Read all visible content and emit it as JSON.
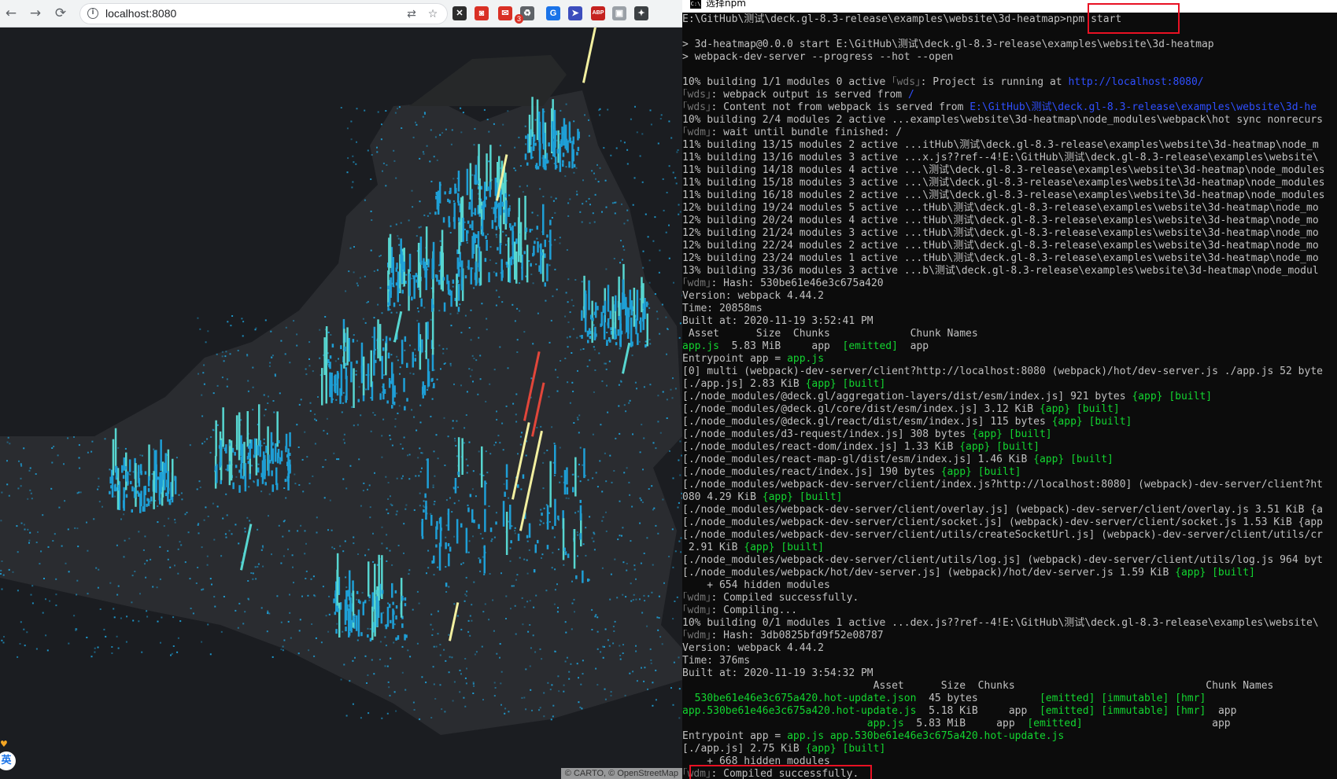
{
  "browser": {
    "url": "localhost:8080",
    "nav": {
      "back": "←",
      "forward": "→",
      "reload": "⟳"
    },
    "extensions": [
      {
        "name": "x-ext",
        "glyph": "✕",
        "color": "#2d2d2d"
      },
      {
        "name": "camera-ext",
        "glyph": "◙",
        "color": "#d93025"
      },
      {
        "name": "mail-ext",
        "glyph": "✉",
        "color": "#d93025"
      },
      {
        "name": "recycle-ext",
        "glyph": "♻",
        "color": "#5f6368"
      },
      {
        "name": "translate-ext",
        "glyph": "G",
        "color": "#1a73e8"
      },
      {
        "name": "cursor-ext",
        "glyph": "➤",
        "color": "#3c4dbd"
      },
      {
        "name": "abp-ext",
        "glyph": "ABP",
        "color": "#c5221f"
      },
      {
        "name": "capture-ext",
        "glyph": "▣",
        "color": "#9aa0a6"
      },
      {
        "name": "puzzle-ext",
        "glyph": "✦",
        "color": "#3c4043"
      }
    ],
    "mail_badge": "3",
    "map": {
      "attribution": "© CARTO, © OpenStreetMap",
      "accent_colors": [
        "#1e9fd6",
        "#57d6d0",
        "#f3f0a0",
        "#e2463a"
      ]
    },
    "ime": {
      "label": "英",
      "heart": "♥"
    }
  },
  "terminal": {
    "title": "选择npm",
    "lines": [
      [
        {
          "t": "E:\\GitHub\\测试\\deck.gl-8.3-release\\examples\\website\\3d-heatmap>npm start"
        }
      ],
      [
        {
          "t": ""
        }
      ],
      [
        {
          "t": "> 3d-heatmap@0.0.0 start E:\\GitHub\\测试\\deck.gl-8.3-release\\examples\\website\\3d-heatmap"
        }
      ],
      [
        {
          "t": "> webpack-dev-server --progress --hot --open"
        }
      ],
      [
        {
          "t": ""
        }
      ],
      [
        {
          "t": "10% building 1/1 modules 0 active "
        },
        {
          "t": "｢wds｣",
          "c": "gr"
        },
        {
          "t": ": Project is running at "
        },
        {
          "t": "http://localhost:8080/",
          "c": "b"
        }
      ],
      [
        {
          "t": "｢wds｣",
          "c": "gr"
        },
        {
          "t": ": webpack output is served from "
        },
        {
          "t": "/",
          "c": "b"
        }
      ],
      [
        {
          "t": "｢wds｣",
          "c": "gr"
        },
        {
          "t": ": Content not from webpack is served from "
        },
        {
          "t": "E:\\GitHub\\测试\\deck.gl-8.3-release\\examples\\website\\3d-he",
          "c": "b"
        }
      ],
      [
        {
          "t": "10% building 2/4 modules 2 active ...examples\\website\\3d-heatmap\\node_modules\\webpack\\hot sync nonrecurs"
        }
      ],
      [
        {
          "t": "｢wdm｣",
          "c": "gr"
        },
        {
          "t": ": wait until bundle finished: /"
        }
      ],
      [
        {
          "t": "11% building 13/15 modules 2 active ...itHub\\测试\\deck.gl-8.3-release\\examples\\website\\3d-heatmap\\node_m"
        }
      ],
      [
        {
          "t": "11% building 13/16 modules 3 active ...x.js??ref--4!E:\\GitHub\\测试\\deck.gl-8.3-release\\examples\\website\\"
        }
      ],
      [
        {
          "t": "11% building 14/18 modules 4 active ...\\测试\\deck.gl-8.3-release\\examples\\website\\3d-heatmap\\node_modules"
        }
      ],
      [
        {
          "t": "11% building 15/18 modules 3 active ...\\测试\\deck.gl-8.3-release\\examples\\website\\3d-heatmap\\node_modules"
        }
      ],
      [
        {
          "t": "11% building 16/18 modules 2 active ...\\测试\\deck.gl-8.3-release\\examples\\website\\3d-heatmap\\node_modules"
        }
      ],
      [
        {
          "t": "12% building 19/24 modules 5 active ...tHub\\测试\\deck.gl-8.3-release\\examples\\website\\3d-heatmap\\node_mo"
        }
      ],
      [
        {
          "t": "12% building 20/24 modules 4 active ...tHub\\测试\\deck.gl-8.3-release\\examples\\website\\3d-heatmap\\node_mo"
        }
      ],
      [
        {
          "t": "12% building 21/24 modules 3 active ...tHub\\测试\\deck.gl-8.3-release\\examples\\website\\3d-heatmap\\node_mo"
        }
      ],
      [
        {
          "t": "12% building 22/24 modules 2 active ...tHub\\测试\\deck.gl-8.3-release\\examples\\website\\3d-heatmap\\node_mo"
        }
      ],
      [
        {
          "t": "12% building 23/24 modules 1 active ...tHub\\测试\\deck.gl-8.3-release\\examples\\website\\3d-heatmap\\node_mo"
        }
      ],
      [
        {
          "t": "13% building 33/36 modules 3 active ...b\\测试\\deck.gl-8.3-release\\examples\\website\\3d-heatmap\\node_modul"
        }
      ],
      [
        {
          "t": "｢wdm｣",
          "c": "gr"
        },
        {
          "t": ": Hash: 530be61e46e3c675a420"
        }
      ],
      [
        {
          "t": "Version: webpack 4.44.2"
        }
      ],
      [
        {
          "t": "Time: 20858ms"
        }
      ],
      [
        {
          "t": "Built at: 2020-11-19 3:52:41 PM"
        }
      ],
      [
        {
          "t": " Asset      Size  Chunks             Chunk Names"
        }
      ],
      [
        {
          "t": "app.js",
          "c": "g"
        },
        {
          "t": "  5.83 MiB     app  "
        },
        {
          "t": "[emitted]",
          "c": "g"
        },
        {
          "t": "  app"
        }
      ],
      [
        {
          "t": "Entrypoint app = "
        },
        {
          "t": "app.js",
          "c": "g"
        }
      ],
      [
        {
          "t": "[0] multi (webpack)-dev-server/client?http://localhost:8080 (webpack)/hot/dev-server.js ./app.js 52 byte"
        }
      ],
      [
        {
          "t": "[./app.js] 2.83 KiB "
        },
        {
          "t": "{app}",
          "c": "g"
        },
        {
          "t": " "
        },
        {
          "t": "[built]",
          "c": "g"
        }
      ],
      [
        {
          "t": "[./node_modules/@deck.gl/aggregation-layers/dist/esm/index.js] 921 bytes "
        },
        {
          "t": "{app}",
          "c": "g"
        },
        {
          "t": " "
        },
        {
          "t": "[built]",
          "c": "g"
        }
      ],
      [
        {
          "t": "[./node_modules/@deck.gl/core/dist/esm/index.js] 3.12 KiB "
        },
        {
          "t": "{app}",
          "c": "g"
        },
        {
          "t": " "
        },
        {
          "t": "[built]",
          "c": "g"
        }
      ],
      [
        {
          "t": "[./node_modules/@deck.gl/react/dist/esm/index.js] 115 bytes "
        },
        {
          "t": "{app}",
          "c": "g"
        },
        {
          "t": " "
        },
        {
          "t": "[built]",
          "c": "g"
        }
      ],
      [
        {
          "t": "[./node_modules/d3-request/index.js] 308 bytes "
        },
        {
          "t": "{app}",
          "c": "g"
        },
        {
          "t": " "
        },
        {
          "t": "[built]",
          "c": "g"
        }
      ],
      [
        {
          "t": "[./node_modules/react-dom/index.js] 1.33 KiB "
        },
        {
          "t": "{app}",
          "c": "g"
        },
        {
          "t": " "
        },
        {
          "t": "[built]",
          "c": "g"
        }
      ],
      [
        {
          "t": "[./node_modules/react-map-gl/dist/esm/index.js] 1.46 KiB "
        },
        {
          "t": "{app}",
          "c": "g"
        },
        {
          "t": " "
        },
        {
          "t": "[built]",
          "c": "g"
        }
      ],
      [
        {
          "t": "[./node_modules/react/index.js] 190 bytes "
        },
        {
          "t": "{app}",
          "c": "g"
        },
        {
          "t": " "
        },
        {
          "t": "[built]",
          "c": "g"
        }
      ],
      [
        {
          "t": "[./node_modules/webpack-dev-server/client/index.js?http://localhost:8080] (webpack)-dev-server/client?ht"
        }
      ],
      [
        {
          "t": "080 4.29 KiB "
        },
        {
          "t": "{app}",
          "c": "g"
        },
        {
          "t": " "
        },
        {
          "t": "[built]",
          "c": "g"
        }
      ],
      [
        {
          "t": "[./node_modules/webpack-dev-server/client/overlay.js] (webpack)-dev-server/client/overlay.js 3.51 KiB {a"
        }
      ],
      [
        {
          "t": "[./node_modules/webpack-dev-server/client/socket.js] (webpack)-dev-server/client/socket.js 1.53 KiB {app"
        }
      ],
      [
        {
          "t": "[./node_modules/webpack-dev-server/client/utils/createSocketUrl.js] (webpack)-dev-server/client/utils/cr"
        }
      ],
      [
        {
          "t": " 2.91 KiB "
        },
        {
          "t": "{app}",
          "c": "g"
        },
        {
          "t": " "
        },
        {
          "t": "[built]",
          "c": "g"
        }
      ],
      [
        {
          "t": "[./node_modules/webpack-dev-server/client/utils/log.js] (webpack)-dev-server/client/utils/log.js 964 byt"
        }
      ],
      [
        {
          "t": "[./node_modules/webpack/hot/dev-server.js] (webpack)/hot/dev-server.js 1.59 KiB "
        },
        {
          "t": "{app}",
          "c": "g"
        },
        {
          "t": " "
        },
        {
          "t": "[built]",
          "c": "g"
        }
      ],
      [
        {
          "t": "    + 654 hidden modules"
        }
      ],
      [
        {
          "t": "｢wdm｣",
          "c": "gr"
        },
        {
          "t": ": Compiled successfully."
        }
      ],
      [
        {
          "t": "｢wdm｣",
          "c": "gr"
        },
        {
          "t": ": Compiling..."
        }
      ],
      [
        {
          "t": "10% building 0/1 modules 1 active ...dex.js??ref--4!E:\\GitHub\\测试\\deck.gl-8.3-release\\examples\\website\\"
        }
      ],
      [
        {
          "t": "｢wdm｣",
          "c": "gr"
        },
        {
          "t": ": Hash: 3db0825bfd9f52e08787"
        }
      ],
      [
        {
          "t": "Version: webpack 4.44.2"
        }
      ],
      [
        {
          "t": "Time: 376ms"
        }
      ],
      [
        {
          "t": "Built at: 2020-11-19 3:54:32 PM"
        }
      ],
      [
        {
          "t": "                               Asset      Size  Chunks                               Chunk Names"
        }
      ],
      [
        {
          "t": "  530be61e46e3c675a420.hot-update.json",
          "c": "g"
        },
        {
          "t": "  45 bytes          "
        },
        {
          "t": "[emitted] [immutable] [hmr]",
          "c": "g"
        }
      ],
      [
        {
          "t": "app.530be61e46e3c675a420.hot-update.js",
          "c": "g"
        },
        {
          "t": "  5.18 KiB     app  "
        },
        {
          "t": "[emitted] [immutable] [hmr]",
          "c": "g"
        },
        {
          "t": "  app"
        }
      ],
      [
        {
          "t": "                              app.js",
          "c": "g"
        },
        {
          "t": "  5.83 MiB     app  "
        },
        {
          "t": "[emitted]",
          "c": "g"
        },
        {
          "t": "                     app"
        }
      ],
      [
        {
          "t": "Entrypoint app = "
        },
        {
          "t": "app.js app.530be61e46e3c675a420.hot-update.js",
          "c": "g"
        }
      ],
      [
        {
          "t": "[./app.js] 2.75 KiB "
        },
        {
          "t": "{app}",
          "c": "g"
        },
        {
          "t": " "
        },
        {
          "t": "[built]",
          "c": "g"
        }
      ],
      [
        {
          "t": "    + 668 hidden modules"
        }
      ],
      [
        {
          "t": "｢wdm｣",
          "c": "gr"
        },
        {
          "t": ": Compiled successfully."
        }
      ]
    ]
  }
}
